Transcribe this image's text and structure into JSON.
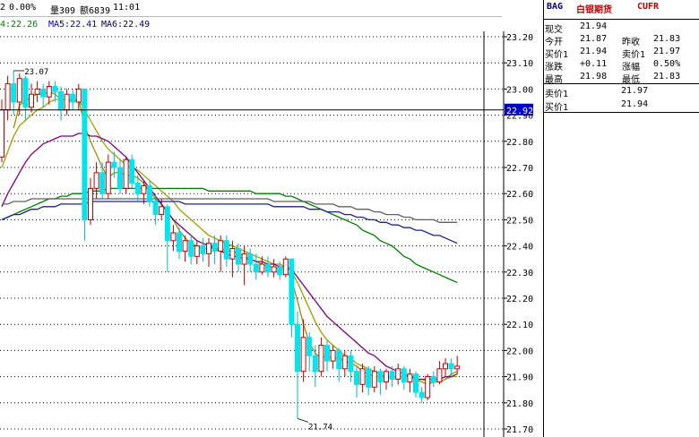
{
  "header": {
    "line1": [
      {
        "text": "2",
        "color": "#000000"
      },
      {
        "text": "0.00%",
        "color": "#000000"
      },
      {
        "text": "量309",
        "color": "#000000"
      },
      {
        "text": "额6839",
        "color": "#000000"
      },
      {
        "text": "11:01",
        "color": "#000000"
      }
    ],
    "ma_line": [
      {
        "text": "4:22.26",
        "color": "#008000"
      },
      {
        "text": "MA5:22.41",
        "color": "#0000c0"
      },
      {
        "text": "MA6:22.49",
        "color": "#000060"
      }
    ]
  },
  "panel": {
    "code": "BAG",
    "name": "白银期货",
    "market": "CUFR",
    "rows": [
      {
        "l1": "现交",
        "v1": "21.94",
        "l2": "",
        "v2": ""
      },
      {
        "l1": "今开",
        "v1": "21.87",
        "l2": "昨收",
        "v2": "21.83"
      },
      {
        "l1": "买价1",
        "v1": "21.94",
        "l2": "卖价1",
        "v2": "21.97"
      },
      {
        "l1": "涨跌",
        "v1": "+0.11",
        "l2": "涨幅",
        "v2": "0.50%"
      },
      {
        "l1": "最高",
        "v1": "21.98",
        "l2": "最低",
        "v2": "21.83"
      }
    ],
    "order_rows": [
      {
        "label": "卖价1",
        "value": "21.97"
      },
      {
        "label": "买价1",
        "value": "21.94"
      }
    ]
  },
  "chart_data": {
    "type": "candlestick",
    "y_ticks": [
      "23.20",
      "23.10",
      "23.00",
      "22.90",
      "22.80",
      "22.70",
      "22.60",
      "22.50",
      "22.40",
      "22.30",
      "22.20",
      "22.10",
      "22.00",
      "21.90",
      "21.80",
      "21.70"
    ],
    "ylim": [
      21.67,
      23.2
    ],
    "current_price_label": "22.92",
    "annotations": [
      {
        "text": "23.07",
        "x_index": 2,
        "y": 23.07
      },
      {
        "text": "21.74",
        "x_index": 50,
        "y": 21.74
      }
    ],
    "candles": [
      [
        22.74,
        22.92,
        22.96,
        22.72
      ],
      [
        22.92,
        23.02,
        23.05,
        22.88
      ],
      [
        23.02,
        22.95,
        23.07,
        22.9
      ],
      [
        22.95,
        23.04,
        23.06,
        22.9
      ],
      [
        23.04,
        22.93,
        23.05,
        22.88
      ],
      [
        22.93,
        22.98,
        23.02,
        22.91
      ],
      [
        22.98,
        23.0,
        23.03,
        22.95
      ],
      [
        23.0,
        22.97,
        23.02,
        22.93
      ],
      [
        22.97,
        23.01,
        23.03,
        22.94
      ],
      [
        23.01,
        22.99,
        23.03,
        22.95
      ],
      [
        22.99,
        22.92,
        23.01,
        22.88
      ],
      [
        22.92,
        22.98,
        23.0,
        22.9
      ],
      [
        22.98,
        22.95,
        23.0,
        22.92
      ],
      [
        22.95,
        23.0,
        23.02,
        22.92
      ],
      [
        23.0,
        22.5,
        23.0,
        22.42
      ],
      [
        22.5,
        22.62,
        22.66,
        22.48
      ],
      [
        22.62,
        22.68,
        22.72,
        22.58
      ],
      [
        22.68,
        22.6,
        22.72,
        22.58
      ],
      [
        22.6,
        22.72,
        22.75,
        22.58
      ],
      [
        22.72,
        22.7,
        22.76,
        22.66
      ],
      [
        22.7,
        22.62,
        22.73,
        22.6
      ],
      [
        22.62,
        22.73,
        22.74,
        22.6
      ],
      [
        22.73,
        22.64,
        22.75,
        22.62
      ],
      [
        22.64,
        22.6,
        22.67,
        22.57
      ],
      [
        22.6,
        22.63,
        22.65,
        22.56
      ],
      [
        22.63,
        22.57,
        22.65,
        22.55
      ],
      [
        22.57,
        22.52,
        22.6,
        22.48
      ],
      [
        22.52,
        22.55,
        22.58,
        22.5
      ],
      [
        22.55,
        22.42,
        22.56,
        22.3
      ],
      [
        22.42,
        22.45,
        22.48,
        22.38
      ],
      [
        22.45,
        22.38,
        22.47,
        22.35
      ],
      [
        22.38,
        22.42,
        22.44,
        22.34
      ],
      [
        22.42,
        22.36,
        22.44,
        22.33
      ],
      [
        22.36,
        22.4,
        22.42,
        22.33
      ],
      [
        22.4,
        22.37,
        22.43,
        22.34
      ],
      [
        22.37,
        22.41,
        22.43,
        22.32
      ],
      [
        22.41,
        22.38,
        22.44,
        22.33
      ],
      [
        22.38,
        22.42,
        22.44,
        22.3
      ],
      [
        22.42,
        22.35,
        22.44,
        22.32
      ],
      [
        22.35,
        22.39,
        22.42,
        22.28
      ],
      [
        22.39,
        22.33,
        22.41,
        22.3
      ],
      [
        22.33,
        22.37,
        22.4,
        22.25
      ],
      [
        22.37,
        22.33,
        22.39,
        22.3
      ],
      [
        22.33,
        22.3,
        22.37,
        22.27
      ],
      [
        22.3,
        22.33,
        22.36,
        22.29
      ],
      [
        22.33,
        22.3,
        22.36,
        22.28
      ],
      [
        22.3,
        22.32,
        22.35,
        22.28
      ],
      [
        22.32,
        22.29,
        22.34,
        22.27
      ],
      [
        22.29,
        22.35,
        22.36,
        22.28
      ],
      [
        22.35,
        22.1,
        22.35,
        22.05
      ],
      [
        22.1,
        21.92,
        22.15,
        21.74
      ],
      [
        21.92,
        22.05,
        22.12,
        21.88
      ],
      [
        22.05,
        21.98,
        22.07,
        21.92
      ],
      [
        21.98,
        21.92,
        22.02,
        21.86
      ],
      [
        21.92,
        22.02,
        22.05,
        21.9
      ],
      [
        22.02,
        21.96,
        22.04,
        21.92
      ],
      [
        21.96,
        22.0,
        22.02,
        21.93
      ],
      [
        22.0,
        21.93,
        22.01,
        21.88
      ],
      [
        21.93,
        21.98,
        22.0,
        21.9
      ],
      [
        21.98,
        21.92,
        22.0,
        21.88
      ],
      [
        21.92,
        21.87,
        21.94,
        21.82
      ],
      [
        21.87,
        21.93,
        21.95,
        21.84
      ],
      [
        21.93,
        21.86,
        21.94,
        21.83
      ],
      [
        21.86,
        21.92,
        21.94,
        21.84
      ],
      [
        21.92,
        21.88,
        21.93,
        21.83
      ],
      [
        21.88,
        21.92,
        21.93,
        21.85
      ],
      [
        21.92,
        21.89,
        21.94,
        21.86
      ],
      [
        21.89,
        21.93,
        21.95,
        21.87
      ],
      [
        21.93,
        21.88,
        21.94,
        21.85
      ],
      [
        21.88,
        21.91,
        21.93,
        21.84
      ],
      [
        21.91,
        21.84,
        21.92,
        21.82
      ],
      [
        21.84,
        21.82,
        21.86,
        21.8
      ],
      [
        21.82,
        21.9,
        21.91,
        21.81
      ],
      [
        21.9,
        21.88,
        21.92,
        21.86
      ],
      [
        21.88,
        21.93,
        21.96,
        21.87
      ],
      [
        21.93,
        21.95,
        21.97,
        21.9
      ],
      [
        21.95,
        21.93,
        21.97,
        21.9
      ],
      [
        21.93,
        21.94,
        21.98,
        21.91
      ]
    ],
    "ma_lines": [
      {
        "color": "#a08c00",
        "values": [
          null,
          null,
          22.85,
          22.94,
          22.95,
          22.97,
          22.98,
          22.98,
          22.99,
          22.98,
          22.96,
          22.96,
          22.95,
          22.96,
          22.86,
          22.8,
          22.75,
          22.7,
          22.66,
          22.68,
          22.68,
          22.67,
          22.67,
          22.66,
          22.64,
          22.61,
          22.58,
          22.56,
          22.53,
          22.5,
          22.46,
          22.43,
          22.41,
          22.4,
          22.39,
          22.39,
          22.39,
          22.39,
          22.38,
          22.38,
          22.37,
          22.36,
          22.35,
          22.34,
          22.33,
          22.32,
          22.32,
          22.31,
          22.31,
          22.27,
          22.19,
          22.1,
          22.03,
          21.99,
          21.97,
          21.98,
          21.97,
          21.97,
          21.96,
          21.95,
          21.94,
          21.92,
          21.91,
          21.9,
          21.9,
          21.9,
          21.9,
          21.9,
          21.9,
          21.9,
          21.89,
          21.88,
          21.87,
          21.88,
          21.88,
          21.89,
          21.91,
          21.92
        ]
      },
      {
        "color": "#a0a000",
        "values": [
          22.7,
          22.76,
          22.82,
          22.86,
          22.88,
          22.9,
          22.92,
          22.93,
          22.95,
          22.96,
          22.96,
          22.96,
          22.96,
          22.96,
          22.92,
          22.88,
          22.84,
          22.8,
          22.77,
          22.75,
          22.73,
          22.71,
          22.7,
          22.69,
          22.67,
          22.65,
          22.63,
          22.61,
          22.59,
          22.57,
          22.54,
          22.52,
          22.5,
          22.48,
          22.46,
          22.44,
          22.43,
          22.42,
          22.41,
          22.4,
          22.39,
          22.38,
          22.37,
          22.36,
          22.35,
          22.34,
          22.33,
          22.33,
          22.32,
          22.3,
          22.26,
          22.21,
          22.16,
          22.11,
          22.07,
          22.04,
          22.02,
          22.0,
          21.98,
          21.97,
          21.95,
          21.94,
          21.93,
          21.92,
          21.91,
          21.9,
          21.9,
          21.9,
          21.9,
          21.9,
          21.89,
          21.89,
          21.88,
          21.88,
          21.88,
          21.89,
          21.9,
          21.9
        ]
      },
      {
        "color": "#800080",
        "values": [
          22.55,
          22.6,
          22.64,
          22.68,
          22.72,
          22.75,
          22.77,
          22.79,
          22.8,
          22.81,
          22.82,
          22.82,
          22.82,
          22.83,
          22.83,
          22.82,
          22.82,
          22.81,
          22.8,
          22.78,
          22.76,
          22.74,
          22.71,
          22.68,
          22.65,
          22.62,
          22.59,
          22.56,
          22.53,
          22.5,
          22.48,
          22.46,
          22.44,
          22.42,
          22.41,
          22.4,
          22.39,
          22.38,
          22.37,
          22.36,
          22.36,
          22.35,
          22.35,
          22.34,
          22.34,
          22.33,
          22.33,
          22.32,
          22.32,
          22.31,
          22.28,
          22.25,
          22.22,
          22.19,
          22.16,
          22.13,
          22.11,
          22.09,
          22.07,
          22.05,
          22.03,
          22.01,
          21.99,
          21.98,
          21.96,
          21.94,
          21.93,
          21.92,
          21.91,
          21.9,
          21.89,
          21.89,
          21.89,
          21.89,
          21.89,
          21.9,
          21.9,
          21.91
        ]
      },
      {
        "color": "#008000",
        "values": [
          22.5,
          22.51,
          22.52,
          22.53,
          22.54,
          22.55,
          22.56,
          22.57,
          22.58,
          22.58,
          22.59,
          22.59,
          22.6,
          22.6,
          22.6,
          22.61,
          22.61,
          22.61,
          22.62,
          22.62,
          22.62,
          22.62,
          22.62,
          22.62,
          22.62,
          22.62,
          22.62,
          22.62,
          22.62,
          22.62,
          22.62,
          22.62,
          22.62,
          22.62,
          22.62,
          22.61,
          22.61,
          22.61,
          22.61,
          22.61,
          22.61,
          22.61,
          22.61,
          22.6,
          22.6,
          22.6,
          22.6,
          22.6,
          22.59,
          22.59,
          22.58,
          22.57,
          22.56,
          22.55,
          22.54,
          22.53,
          22.52,
          22.51,
          22.5,
          22.49,
          22.48,
          22.46,
          22.45,
          22.44,
          22.42,
          22.41,
          22.4,
          22.38,
          22.36,
          22.35,
          22.33,
          22.32,
          22.31,
          22.3,
          22.29,
          22.28,
          22.27,
          22.26
        ]
      },
      {
        "color": "#1c2480",
        "values": [
          22.5,
          22.51,
          22.52,
          22.52,
          22.53,
          22.54,
          22.54,
          22.55,
          22.55,
          22.55,
          22.56,
          22.56,
          22.56,
          22.56,
          22.56,
          22.57,
          22.57,
          22.57,
          22.57,
          22.57,
          22.57,
          22.57,
          22.57,
          22.57,
          22.57,
          22.57,
          22.57,
          22.57,
          22.57,
          22.57,
          22.57,
          22.56,
          22.56,
          22.56,
          22.56,
          22.56,
          22.56,
          22.56,
          22.56,
          22.56,
          22.56,
          22.56,
          22.56,
          22.56,
          22.56,
          22.56,
          22.55,
          22.55,
          22.55,
          22.55,
          22.55,
          22.55,
          22.54,
          22.54,
          22.54,
          22.53,
          22.53,
          22.53,
          22.52,
          22.52,
          22.51,
          22.51,
          22.5,
          22.5,
          22.49,
          22.49,
          22.48,
          22.48,
          22.47,
          22.47,
          22.46,
          22.46,
          22.45,
          22.44,
          22.44,
          22.43,
          22.42,
          22.41
        ]
      },
      {
        "color": "#606060",
        "values": [
          22.56,
          22.56,
          22.57,
          22.57,
          22.57,
          22.58,
          22.58,
          22.58,
          22.58,
          22.58,
          22.58,
          22.58,
          22.58,
          22.58,
          22.58,
          22.58,
          22.58,
          22.58,
          22.58,
          22.58,
          22.58,
          22.58,
          22.58,
          22.58,
          22.58,
          22.58,
          22.58,
          22.58,
          22.58,
          22.58,
          22.58,
          22.58,
          22.58,
          22.58,
          22.58,
          22.58,
          22.58,
          22.58,
          22.58,
          22.58,
          22.58,
          22.58,
          22.58,
          22.58,
          22.58,
          22.58,
          22.57,
          22.57,
          22.57,
          22.57,
          22.57,
          22.57,
          22.57,
          22.56,
          22.56,
          22.56,
          22.56,
          22.55,
          22.55,
          22.55,
          22.54,
          22.54,
          22.54,
          22.53,
          22.53,
          22.52,
          22.52,
          22.52,
          22.51,
          22.51,
          22.5,
          22.5,
          22.5,
          22.5,
          22.49,
          22.49,
          22.49,
          22.49
        ]
      }
    ],
    "up_color": "#c00000",
    "down_color": "#00e5ee"
  }
}
